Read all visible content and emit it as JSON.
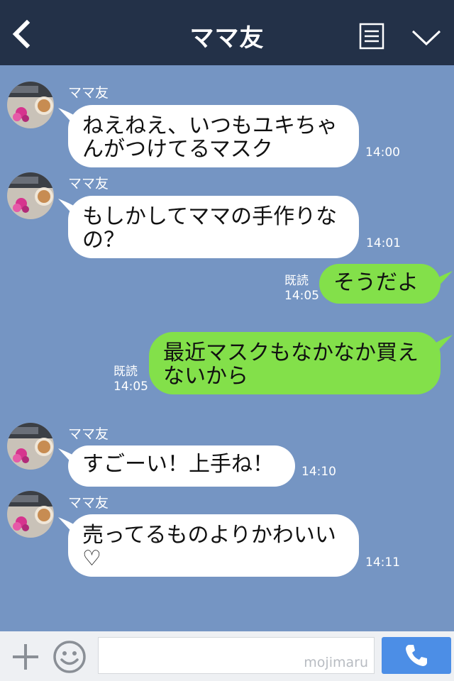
{
  "header": {
    "title": "ママ友",
    "back_icon": "chevron-left-icon",
    "menu_icon": "document-icon",
    "more_icon": "chevron-down-icon"
  },
  "colors": {
    "header_bg": "#233148",
    "chat_bg": "#7595c3",
    "incoming_bubble": "#ffffff",
    "outgoing_bubble": "#83e04a",
    "send_button": "#4c8ee6"
  },
  "messages": [
    {
      "direction": "in",
      "sender": "ママ友",
      "line1": "ねえねえ、いつもユキちゃ",
      "line2": "んがつけてるマスク",
      "time": "14:00"
    },
    {
      "direction": "in",
      "sender": "ママ友",
      "line1": "もしかしてママの手作りな",
      "line2": "の？",
      "time": "14:01"
    },
    {
      "direction": "out",
      "read": "既読",
      "line1": "そうだよ",
      "time": "14:05"
    },
    {
      "direction": "out",
      "read": "既読",
      "line1": "最近マスクもなかなか買え",
      "line2": "ないから",
      "time": "14:05"
    },
    {
      "direction": "in",
      "sender": "ママ友",
      "line1": "すごーい！上手ね！",
      "time": "14:10"
    },
    {
      "direction": "in",
      "sender": "ママ友",
      "line1": "売ってるものよりかわいい",
      "line2": "♡",
      "time": "14:11"
    }
  ],
  "input_bar": {
    "plus_icon": "plus-icon",
    "emoji_icon": "smiley-icon",
    "watermark": "mojimaru",
    "call_icon": "phone-icon"
  }
}
